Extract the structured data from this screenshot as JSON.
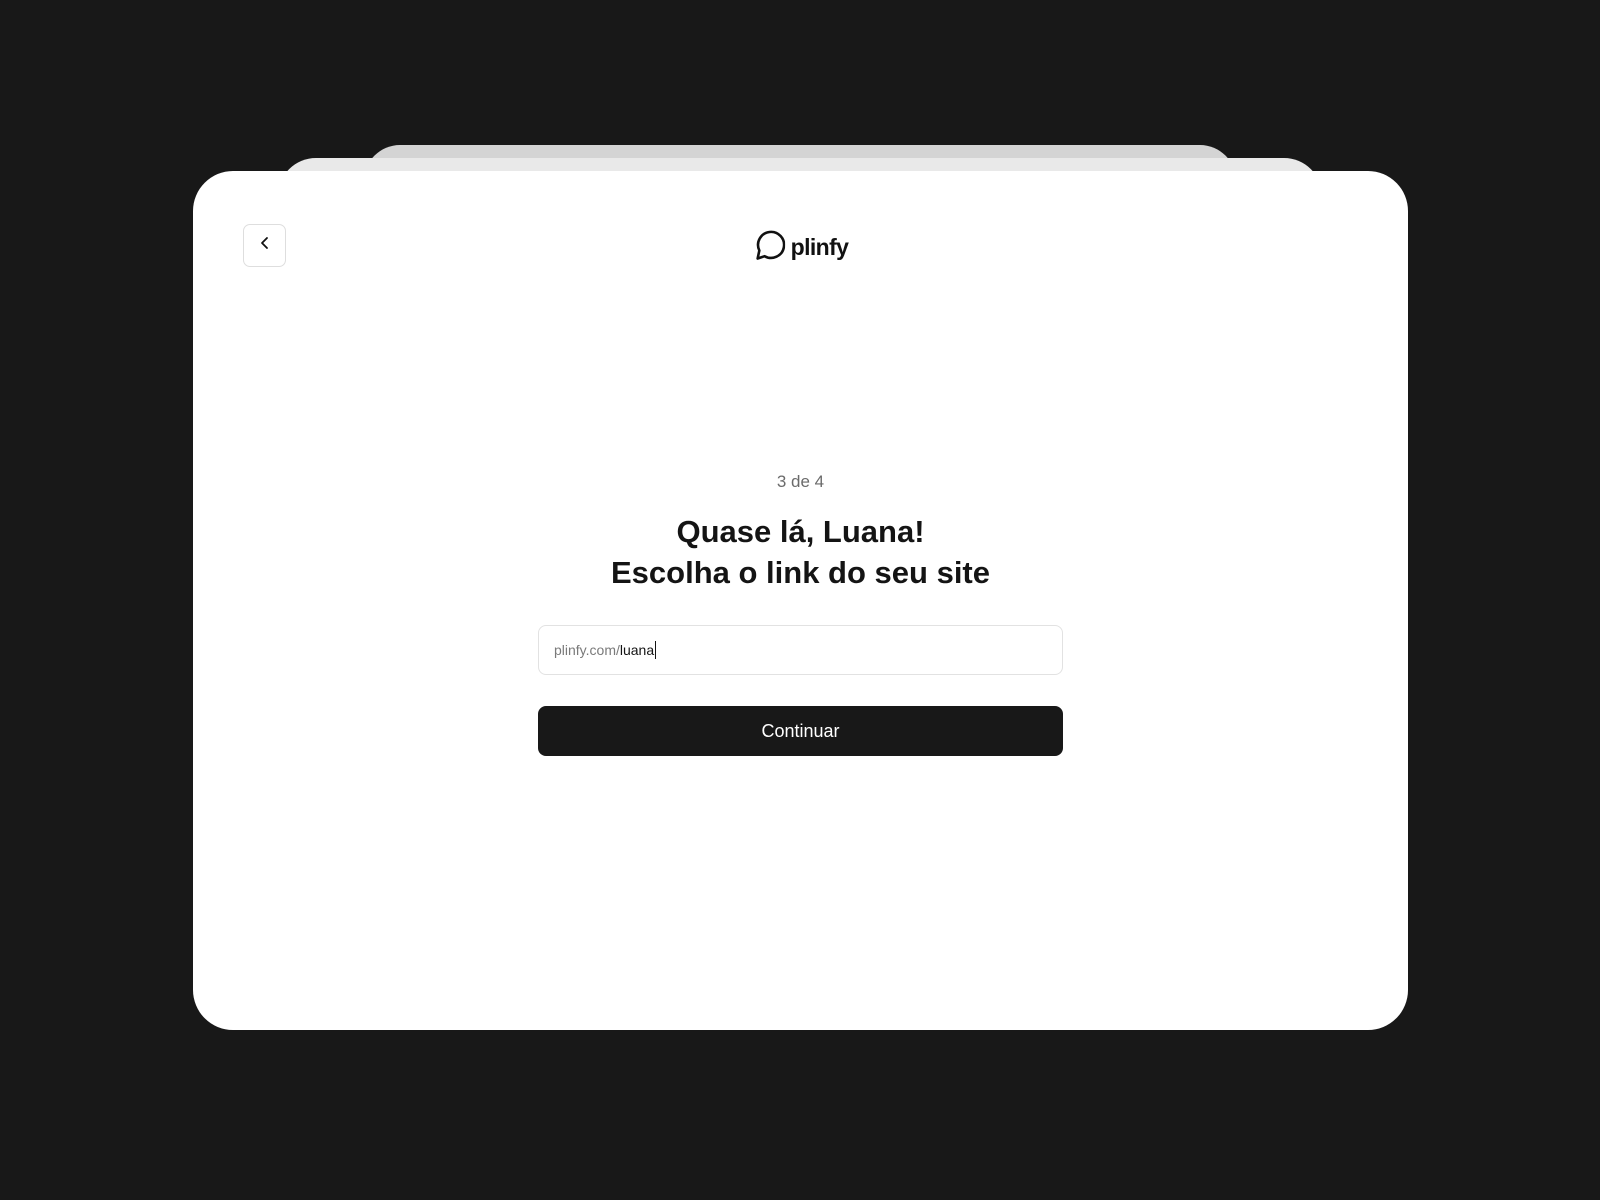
{
  "brand": {
    "name": "plinfy",
    "logo_icon": "speech-bubble-icon"
  },
  "nav": {
    "back_icon": "chevron-left-icon"
  },
  "onboarding": {
    "step": "3 de 4",
    "title_line1": "Quase lá, Luana!",
    "title_line2": "Escolha o link do seu site"
  },
  "link_field": {
    "prefix": "plinfy.com/",
    "value": "luana"
  },
  "actions": {
    "continue_label": "Continuar"
  },
  "colors": {
    "background": "#181818",
    "card": "#ffffff",
    "primary_button": "#181818",
    "muted_text": "#6b6b6b"
  }
}
